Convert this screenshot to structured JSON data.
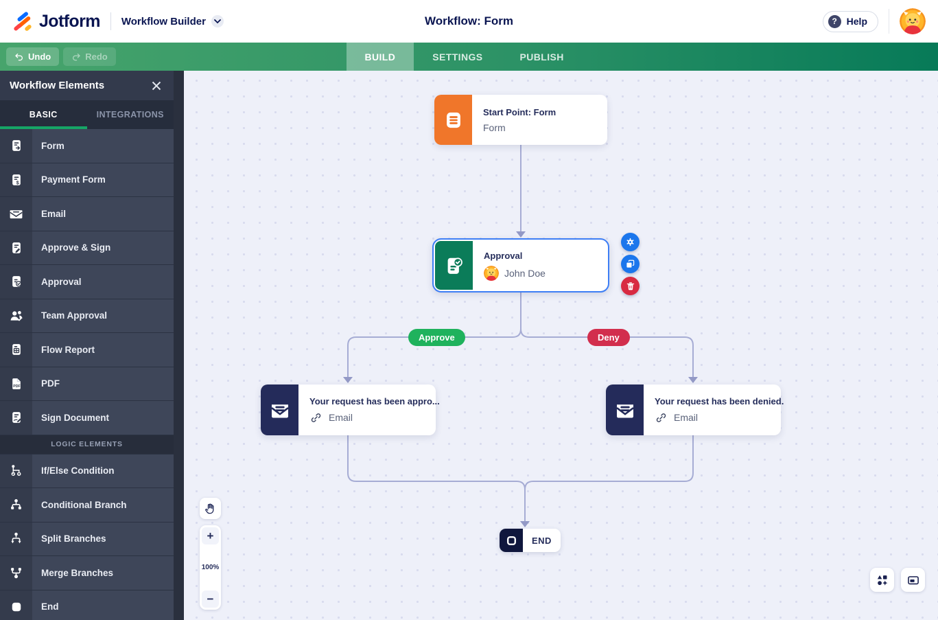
{
  "header": {
    "logo": "Jotform",
    "product_label": "Workflow Builder",
    "title": "Workflow: Form",
    "help_label": "Help",
    "help_icon": "?"
  },
  "toolbar": {
    "undo": "Undo",
    "redo": "Redo",
    "tabs": {
      "build": "BUILD",
      "settings": "SETTINGS",
      "publish": "PUBLISH"
    }
  },
  "sidebar": {
    "title": "Workflow Elements",
    "tab_basic": "BASIC",
    "tab_integrations": "INTEGRATIONS",
    "section_logic": "LOGIC ELEMENTS",
    "items": [
      "Form",
      "Payment Form",
      "Email",
      "Approve & Sign",
      "Approval",
      "Team Approval",
      "Flow Report",
      "PDF",
      "Sign Document"
    ],
    "logic_items": [
      "If/Else Condition",
      "Conditional Branch",
      "Split Branches",
      "Merge Branches",
      "End"
    ]
  },
  "canvas": {
    "start": {
      "title": "Start Point: Form",
      "subtitle": "Form"
    },
    "approval": {
      "title": "Approval",
      "assignee": "John Doe"
    },
    "email_approve": {
      "title": "Your request has been appro...",
      "subtitle": "Email"
    },
    "email_deny": {
      "title": "Your request has been denied.",
      "subtitle": "Email"
    },
    "end_label": "END",
    "branch_approve": "Approve",
    "branch_deny": "Deny",
    "zoom_level": "100%",
    "zoom_in": "+",
    "zoom_out": "−"
  },
  "colors": {
    "brand_navy": "#0a1551",
    "toolbar_green_left": "#47a46c",
    "toolbar_green_right": "#077a58",
    "accent_green": "#16a566",
    "start_orange": "#f0762a",
    "approval_green": "#0b7c59",
    "node_navy": "#242b5a",
    "selection_blue": "#3d7ef5",
    "approve_pill_green": "#1fb25d",
    "deny_pill_red": "#d22e4d",
    "action_blue": "#1b76ec",
    "danger_red": "#d82a41",
    "canvas_bg": "#eef0f9",
    "connector": "#a6acd4",
    "sidebar_bg": "#3e4659"
  }
}
